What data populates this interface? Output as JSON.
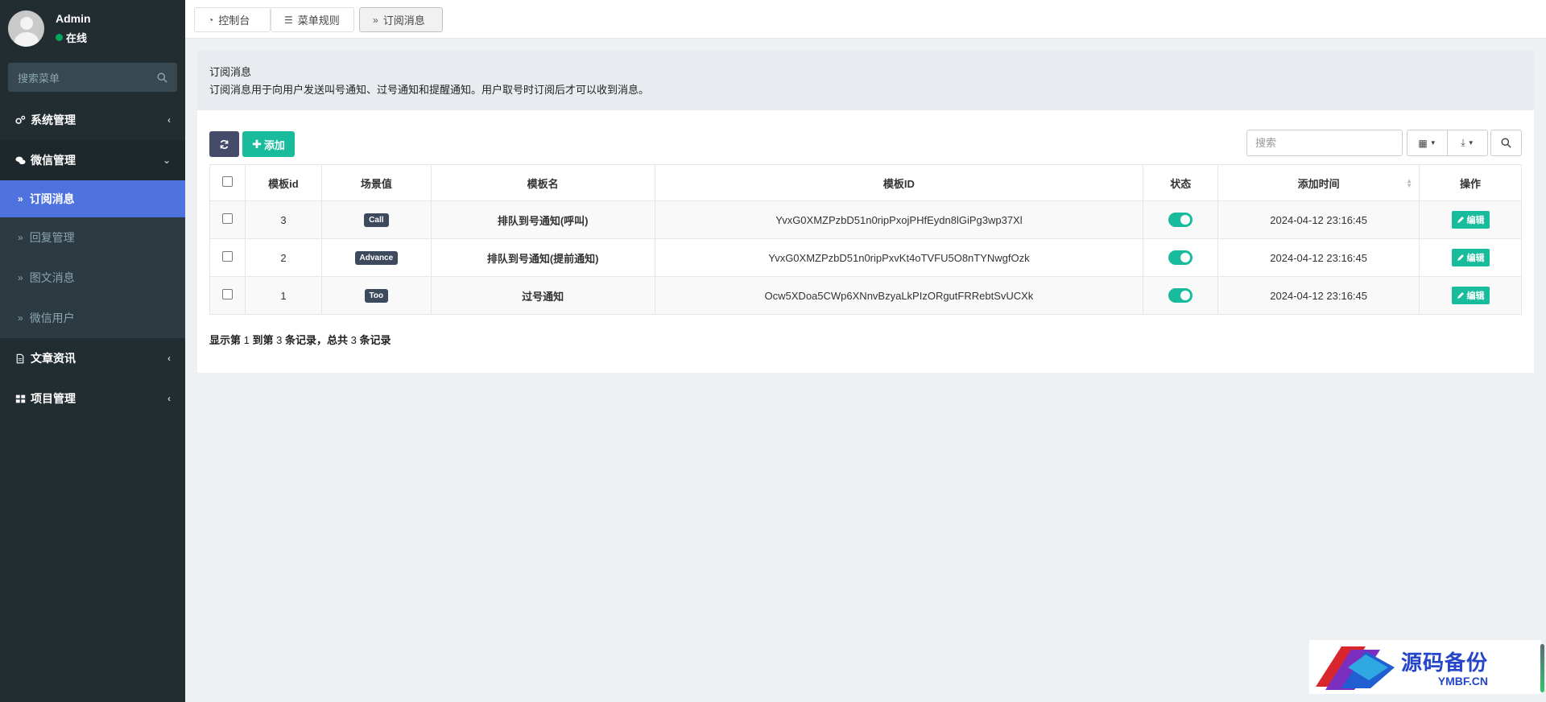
{
  "sidebar": {
    "user": {
      "name": "Admin",
      "status": "在线"
    },
    "search_placeholder": "搜索菜单",
    "menu": [
      {
        "label": "系统管理",
        "icon": "cogs-icon"
      },
      {
        "label": "微信管理",
        "icon": "comments-icon"
      },
      {
        "label": "文章资讯",
        "icon": "file-text-icon"
      },
      {
        "label": "项目管理",
        "icon": "th-large-icon"
      }
    ],
    "submenu": [
      {
        "label": "订阅消息"
      },
      {
        "label": "回复管理"
      },
      {
        "label": "图文消息"
      },
      {
        "label": "微信用户"
      }
    ]
  },
  "tabs": [
    {
      "label": "控制台",
      "icon": "dashboard-icon"
    },
    {
      "label": "菜单规则",
      "icon": "list-icon"
    },
    {
      "label": "订阅消息",
      "icon": "double-chevron-icon"
    }
  ],
  "intro": {
    "title": "订阅消息",
    "description": "订阅消息用于向用户发送叫号通知、过号通知和提醒通知。用户取号时订阅后才可以收到消息。"
  },
  "toolbar": {
    "add_label": "添加",
    "search_placeholder": "搜索"
  },
  "table": {
    "headers": [
      "模板id",
      "场景值",
      "模板名",
      "模板ID",
      "状态",
      "添加时间",
      "操作"
    ],
    "rows": [
      {
        "id": "3",
        "scene": "Call",
        "name": "排队到号通知(呼叫)",
        "template_id": "YvxG0XMZPzbD51n0ripPxojPHfEydn8lGiPg3wp37Xl",
        "status_on": true,
        "time": "2024-04-12 23:16:45",
        "action": "编辑"
      },
      {
        "id": "2",
        "scene": "Advance",
        "name": "排队到号通知(提前通知)",
        "template_id": "YvxG0XMZPzbD51n0ripPxvKt4oTVFU5O8nTYNwgfOzk",
        "status_on": true,
        "time": "2024-04-12 23:16:45",
        "action": "编辑"
      },
      {
        "id": "1",
        "scene": "Too",
        "name": "过号通知",
        "template_id": "Ocw5XDoa5CWp6XNnvBzyaLkPIzORgutFRRebtSvUCXk",
        "status_on": true,
        "time": "2024-04-12 23:16:45",
        "action": "编辑"
      }
    ]
  },
  "pagination": {
    "prefix": "显示第",
    "from": "1",
    "mid1": "到第",
    "to": "3",
    "mid2": "条记录，总共",
    "total": "3",
    "suffix": "条记录"
  },
  "watermark": {
    "cn": "源码备份",
    "en": "YMBF.CN"
  },
  "colors": {
    "sidebar_bg": "#222d32",
    "active_menu": "#4e73df",
    "accent_green": "#18bc9c",
    "badge_dark": "#3d4a5d"
  }
}
